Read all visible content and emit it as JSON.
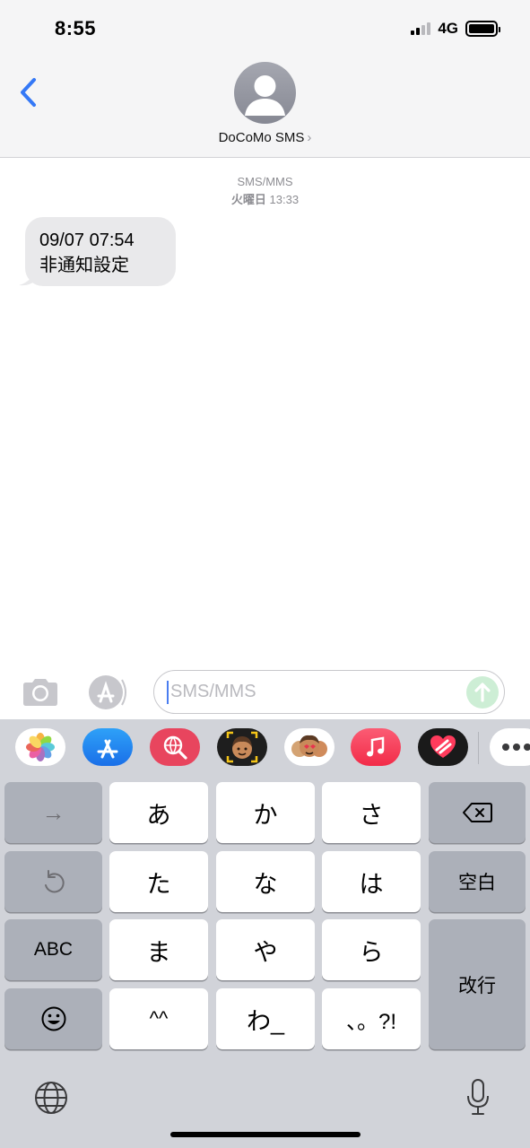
{
  "status_bar": {
    "time": "8:55",
    "network": "4G"
  },
  "header": {
    "contact_name": "DoCoMo SMS",
    "chevron": "›"
  },
  "conversation": {
    "service_label": "SMS/MMS",
    "day_label": "火曜日",
    "time_label": "13:33",
    "messages": [
      {
        "lines": [
          "09/07 07:54",
          "非通知設定"
        ],
        "direction": "incoming"
      }
    ]
  },
  "composer": {
    "placeholder": "SMS/MMS"
  },
  "app_strip": {
    "apps": [
      "photos-app",
      "app-store-app",
      "web-search-app",
      "memoji-app",
      "memoji-stickers-app",
      "music-app",
      "digital-touch-app",
      "more-apps"
    ]
  },
  "keyboard": {
    "rows": [
      [
        "→",
        "あ",
        "か",
        "さ",
        "delete"
      ],
      [
        "undo",
        "た",
        "な",
        "は",
        "空白"
      ],
      [
        "ABC",
        "ま",
        "や",
        "ら",
        "改行"
      ],
      [
        "emoji",
        "^^",
        "わ_",
        "、。?!"
      ]
    ],
    "keys": {
      "arrow": "→",
      "a": "あ",
      "ka": "か",
      "sa": "さ",
      "ta": "た",
      "na": "な",
      "ha": "は",
      "space": "空白",
      "abc": "ABC",
      "ma": "ま",
      "ya": "や",
      "ra": "ら",
      "return": "改行",
      "kaomoji": "^^",
      "wa": "わ_",
      "punct": "、。?!"
    }
  },
  "colors": {
    "accent": "#3478f6",
    "send_disabled": "#cdeed5",
    "bubble": "#e9e9eb",
    "keyboard_bg": "#d1d3d9"
  }
}
